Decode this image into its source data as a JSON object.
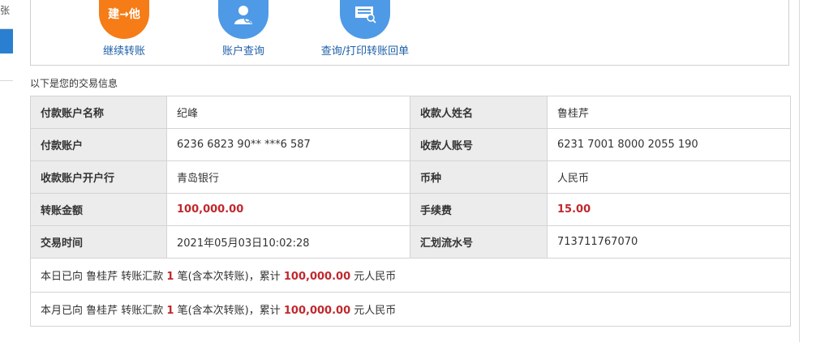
{
  "sidebar": {
    "partial_text": "张"
  },
  "actions": [
    {
      "icon_text": "建→他",
      "label": "继续转账"
    },
    {
      "label": "账户查询"
    },
    {
      "label": "查询/打印转账回单"
    }
  ],
  "info_title": "以下是您的交易信息",
  "fields": {
    "payer_name_label": "付款账户名称",
    "payer_name": "纪峰",
    "payee_name_label": "收款人姓名",
    "payee_name": "鲁桂芹",
    "payer_account_label": "付款账户",
    "payer_account": "6236 6823 90** ***6 587",
    "payee_account_label": "收款人账号",
    "payee_account": "6231 7001 8000 2055 190",
    "payee_bank_label": "收款账户开户行",
    "payee_bank": "青岛银行",
    "currency_label": "币种",
    "currency": "人民币",
    "amount_label": "转账金额",
    "amount": "100,000.00",
    "fee_label": "手续费",
    "fee": "15.00",
    "time_label": "交易时间",
    "time": "2021年05月03日10:02:28",
    "serial_label": "汇划流水号",
    "serial": "713711767070"
  },
  "daily_note": {
    "prefix": "本日已向 ",
    "payee": "鲁桂芹",
    "mid1": " 转账汇款 ",
    "count": "1",
    "mid2": " 笔(含本次转账)，累计 ",
    "total": "100,000.00",
    "suffix": " 元人民币"
  },
  "monthly_note": {
    "prefix": "本月已向 ",
    "payee": "鲁桂芹",
    "mid1": " 转账汇款 ",
    "count": "1",
    "mid2": " 笔(含本次转账)，累计 ",
    "total": "100,000.00",
    "suffix": " 元人民币"
  },
  "colors": {
    "accent_blue": "#4e9ae6",
    "accent_orange": "#f57c16",
    "amount_red": "#c0282d",
    "link_blue": "#1d5fa8"
  }
}
